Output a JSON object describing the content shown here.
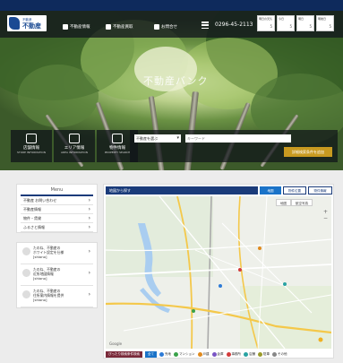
{
  "header": {
    "logo_top": "不動産",
    "logo_main": "不動産",
    "nav": [
      {
        "label": "不動産情報",
        "icon": "home-icon"
      },
      {
        "label": "不動産買取",
        "icon": "building-icon"
      },
      {
        "label": "お問合せ",
        "icon": "key-icon"
      }
    ],
    "phone": "0296-45-2113",
    "weather": [
      {
        "label": "明日の天気",
        "value": "5"
      },
      {
        "label": "今日",
        "value": "5"
      },
      {
        "label": "明日",
        "value": "5"
      },
      {
        "label": "明後日",
        "value": "5"
      }
    ]
  },
  "hero": {
    "title": "不動産バンク"
  },
  "quick_links": [
    {
      "label": "店舗情報",
      "sub": "STORE INFORMATION",
      "icon": "store-icon"
    },
    {
      "label": "エリア情報",
      "sub": "AREA INFORMATION",
      "icon": "map-pin-icon"
    },
    {
      "label": "物件情報",
      "sub": "PROPERTY SEARCH",
      "icon": "search-house-icon"
    }
  ],
  "search": {
    "category_select": "不動産を選ぶ",
    "keyword_placeholder": "キーワード",
    "detail_button": "詳細検索条件を追加"
  },
  "sidebar": {
    "title": "Menu",
    "items": [
      "不動産 お問い合わせ",
      "不動産情報",
      "物件・賃貸",
      "ふるさと情報"
    ]
  },
  "properties": [
    {
      "line1": "たのね、不動産の",
      "line2": "ホワイト設定を仕様",
      "line3": "[shiono]"
    },
    {
      "line1": "たのね、不動産の",
      "line2": "近所地図情報",
      "line3": "[shiono]"
    },
    {
      "line1": "たのね、不動産の",
      "line2": "住所案内情報を提供",
      "line3": "[shiono]"
    }
  ],
  "map": {
    "title": "地図から探す",
    "tabs": [
      "地図",
      "物件位置",
      "物件情報"
    ],
    "map_type": [
      "地図",
      "航空写真"
    ],
    "zoom_in": "+",
    "zoom_out": "−",
    "google_label": "Google",
    "legend_pill": "ぴったり検索条件検索",
    "legend_all": "全て",
    "legend_items": [
      {
        "label": "売地",
        "color": "#2e7bd6"
      },
      {
        "label": "マンション",
        "color": "#3aa24a"
      },
      {
        "label": "戸建",
        "color": "#e08a1e"
      },
      {
        "label": "倉庫",
        "color": "#7a55c4"
      },
      {
        "label": "事務所",
        "color": "#d23c3c"
      },
      {
        "label": "店舗",
        "color": "#2aa3a3"
      },
      {
        "label": "駐車",
        "color": "#9a9a2a"
      },
      {
        "label": "その他",
        "color": "#888888"
      }
    ]
  }
}
